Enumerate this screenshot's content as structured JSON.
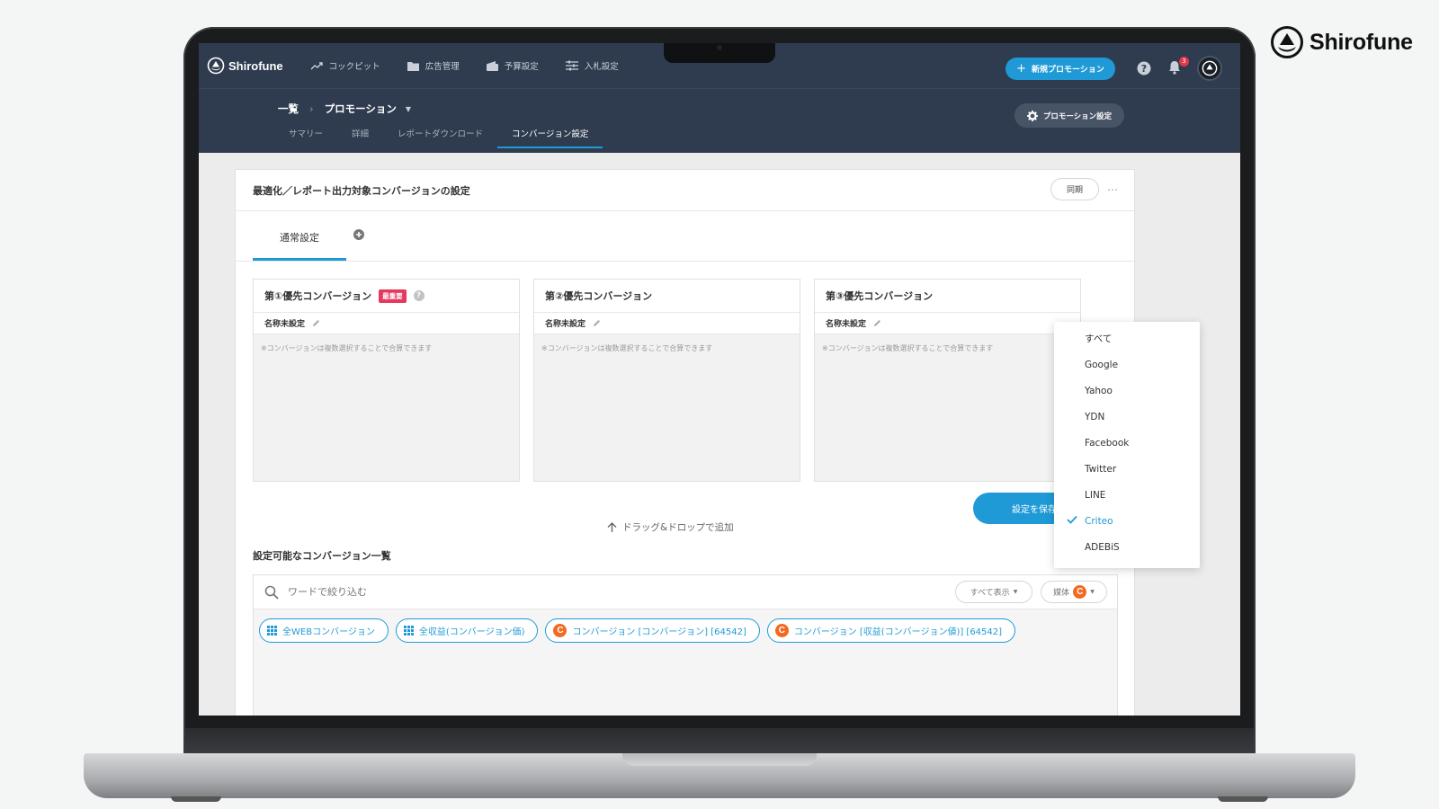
{
  "brand": {
    "name": "Shirofune"
  },
  "app": {
    "logo_text": "Shirofune"
  },
  "nav": {
    "items": [
      {
        "label": "コックピット",
        "icon": "trend-icon"
      },
      {
        "label": "広告管理",
        "icon": "folder-icon"
      },
      {
        "label": "予算設定",
        "icon": "wallet-icon"
      },
      {
        "label": "入札設定",
        "icon": "sliders-icon"
      }
    ],
    "new_promotion": "新規プロモーション",
    "notification_count": "3"
  },
  "breadcrumb": {
    "root": "一覧",
    "current": "プロモーション"
  },
  "subtabs": [
    {
      "label": "サマリー",
      "active": false
    },
    {
      "label": "詳細",
      "active": false
    },
    {
      "label": "レポートダウンロード",
      "active": false
    },
    {
      "label": "コンバージョン設定",
      "active": true
    }
  ],
  "promotion_settings": "プロモーション設定",
  "card": {
    "title": "最適化／レポート出力対象コンバージョンの設定",
    "sync": "同期",
    "more": "…",
    "tab_normal": "通常設定"
  },
  "priorities": [
    {
      "title": "第①優先コンバージョン",
      "badge": "最重要",
      "name": "名称未設定",
      "hint": "※コンバージョンは複数選択することで合算できます"
    },
    {
      "title": "第②優先コンバージョン",
      "name": "名称未設定",
      "hint": "※コンバージョンは複数選択することで合算できます"
    },
    {
      "title": "第③優先コンバージョン",
      "name": "名称未設定",
      "hint": "※コンバージョンは複数選択することで合算できます"
    }
  ],
  "save_button": "設定を保存",
  "drag_hint": "ドラッグ&ドロップで追加",
  "list": {
    "title": "設定可能なコンバージョン一覧",
    "search_placeholder": "ワードで絞り込む",
    "show_all": "すべて表示",
    "media": "媒体",
    "chips": [
      {
        "label": "全WEBコンバージョン",
        "icon": "grid-icon"
      },
      {
        "label": "全収益(コンバージョン価)",
        "icon": "grid-icon"
      },
      {
        "label": "コンバージョン [コンバージョン] [64542]",
        "icon": "criteo-icon"
      },
      {
        "label": "コンバージョン [収益(コンバージョン値)] [64542]",
        "icon": "criteo-icon"
      }
    ]
  },
  "media_menu": {
    "items": [
      "すべて",
      "Google",
      "Yahoo",
      "YDN",
      "Facebook",
      "Twitter",
      "LINE",
      "Criteo",
      "ADEBiS"
    ],
    "selected": "Criteo"
  },
  "colors": {
    "accent": "#1f9ad6",
    "nav_bg": "#2f3c4f",
    "danger": "#e3395f",
    "criteo": "#f26a21"
  }
}
